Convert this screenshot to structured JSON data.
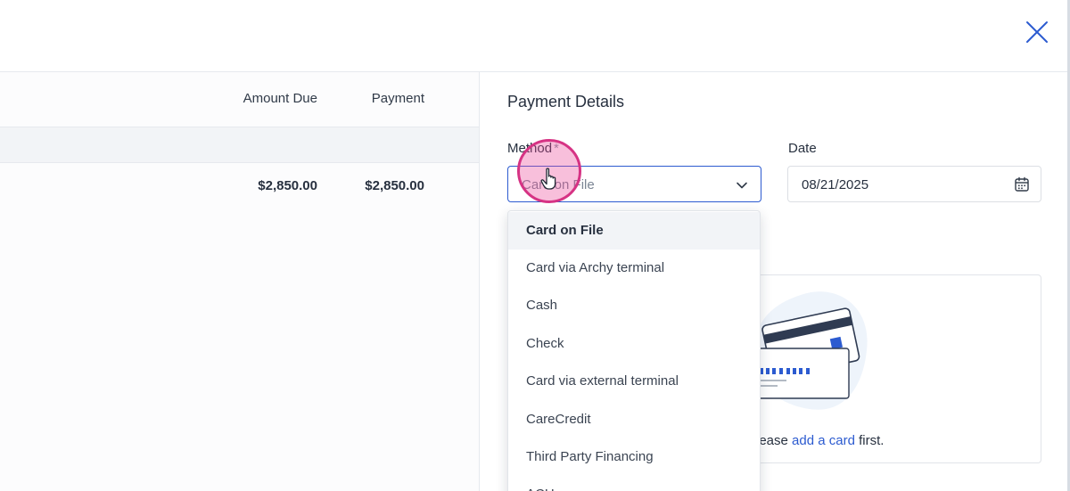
{
  "window": {
    "close_icon": "close-icon"
  },
  "table": {
    "columns": {
      "amount_due": "Amount Due",
      "payment": "Payment"
    },
    "rows": [
      {
        "amount_due": "$2,850.00",
        "payment": "$2,850.00"
      }
    ]
  },
  "payment_details": {
    "title": "Payment Details",
    "method": {
      "label": "Method",
      "required_mark": "*",
      "value": "Card on File",
      "options": [
        "Card on File",
        "Card via Archy terminal",
        "Cash",
        "Check",
        "Card via external terminal",
        "CareCredit",
        "Third Party Financing",
        "ACH"
      ],
      "selected_index": 0
    },
    "date": {
      "label": "Date",
      "value": "08/21/2025",
      "icon": "calendar-icon"
    },
    "empty_state": {
      "prefix": "Please ",
      "link": "add a card",
      "suffix": " first."
    }
  },
  "colors": {
    "accent": "#2c5bd0",
    "text": "#27303f",
    "highlight_ring": "#d63384"
  }
}
